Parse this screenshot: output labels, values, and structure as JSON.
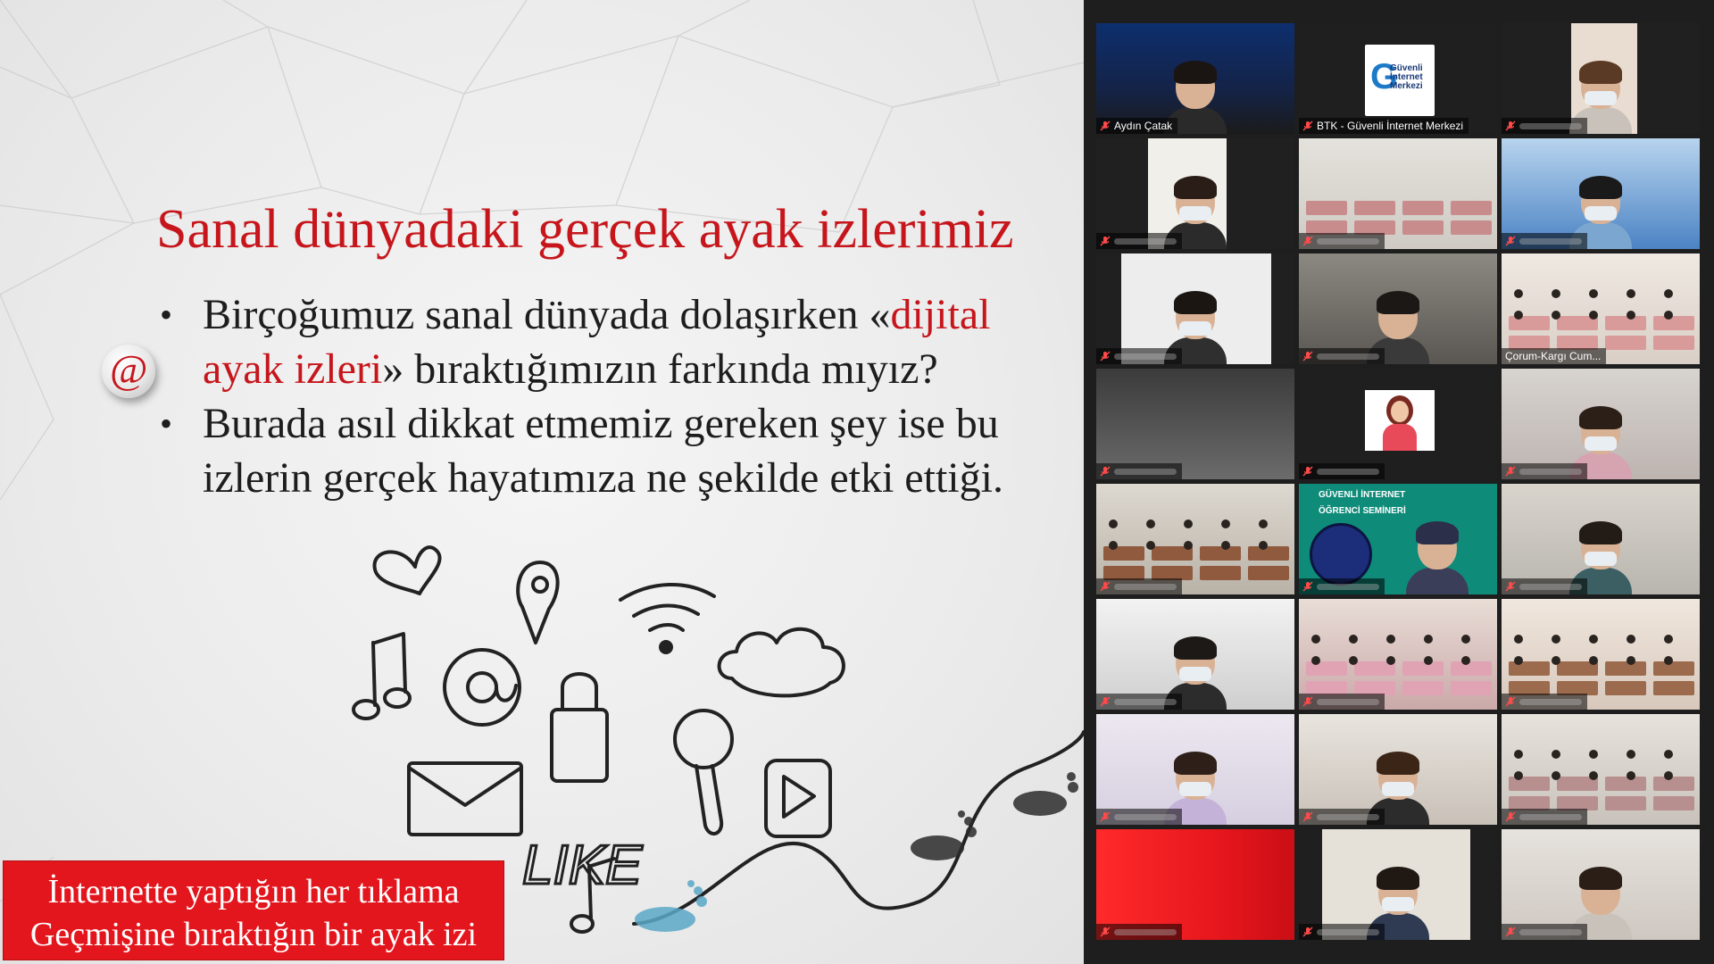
{
  "slide": {
    "title": "Sanal dünyadaki gerçek ayak izlerimiz",
    "bullets": [
      {
        "part1": "Birçoğumuz sanal dünyada dolaşırken «",
        "highlight_a": "dijital",
        "highlight_b": "ayak izleri",
        "part2": "» bıraktığımızın farkında mıyız?"
      },
      {
        "line1": "Burada asıl dikkat etmemiz gereken şey ise bu",
        "line2": "izlerin gerçek hayatımıza ne şekilde etki ettiği."
      }
    ],
    "bullet_symbol": "•",
    "at_symbol": "@",
    "doodle_text": "LIKE",
    "caption": {
      "line1": "İnternette yaptığın her tıklama",
      "line2": "Geçmişine bıraktığın bir ayak izi"
    },
    "colors": {
      "title": "#c6161c",
      "caption_bg": "#e3161d"
    }
  },
  "gallery": {
    "participants": [
      {
        "name": "Aydın Çatak",
        "active": true,
        "muted": true
      },
      {
        "name": "BTK - Güvenli İnternet Merkezi",
        "muted": true,
        "logo": "Güvenli İnternet Merkezi"
      },
      {
        "name": "",
        "muted": true
      },
      {
        "name": "",
        "muted": true
      },
      {
        "name": "",
        "muted": true
      },
      {
        "name": "",
        "muted": true
      },
      {
        "name": "",
        "muted": true
      },
      {
        "name": "",
        "muted": true
      },
      {
        "name": "Çorum-Kargı Cum...",
        "muted": false
      },
      {
        "name": "",
        "muted": true
      },
      {
        "name": "",
        "muted": true
      },
      {
        "name": "",
        "muted": true
      },
      {
        "name": "",
        "muted": true
      },
      {
        "name": "",
        "muted": true
      },
      {
        "name": "",
        "muted": true
      },
      {
        "name": "",
        "muted": true
      },
      {
        "name": "",
        "muted": true
      },
      {
        "name": "",
        "muted": true
      },
      {
        "name": "",
        "muted": true
      },
      {
        "name": "",
        "muted": true
      },
      {
        "name": "",
        "muted": true
      },
      {
        "name": "",
        "muted": true
      },
      {
        "name": "",
        "muted": true
      },
      {
        "name": "",
        "muted": true
      }
    ],
    "seminar_banner": [
      "GÜVENLİ İNTERNET",
      "ÖĞRENCİ SEMİNERİ"
    ]
  }
}
